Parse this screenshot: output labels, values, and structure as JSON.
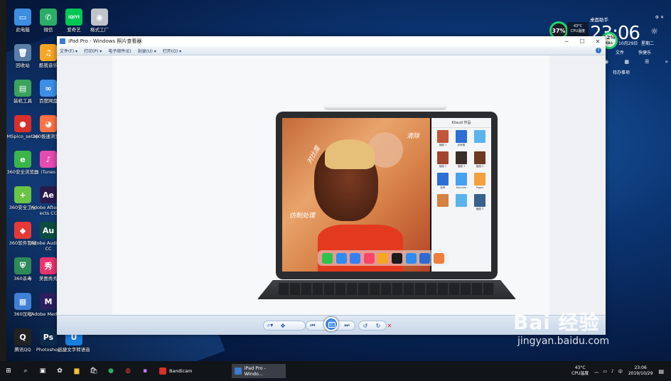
{
  "desktop": {
    "icons": [
      {
        "label": "此电脑",
        "glyph": "▭",
        "color": "#3c8ee0"
      },
      {
        "label": "微信",
        "glyph": "✆",
        "color": "#2aae67"
      },
      {
        "label": "爱奇艺",
        "glyph": "iQIYI",
        "color": "#00c853"
      },
      {
        "label": "格式工厂",
        "glyph": "◉",
        "color": "#c0c5cc"
      },
      {
        "label": "回收站",
        "glyph": "🗑",
        "color": "#5a7ea8"
      },
      {
        "label": "酷我音乐",
        "glyph": "♫",
        "color": "#f6a623"
      },
      {
        "label": "装机工具",
        "glyph": "▤",
        "color": "#3aa35c"
      },
      {
        "label": "百度网盘",
        "glyph": "∞",
        "color": "#3d8ee8"
      },
      {
        "label": "MSpico_setup",
        "glyph": "●",
        "color": "#d9302a"
      },
      {
        "label": "360极速浏览器",
        "glyph": "◕",
        "color": "#ff7043"
      },
      {
        "label": "360安全浏览器",
        "glyph": "e",
        "color": "#3ab54a"
      },
      {
        "label": "iTunes",
        "glyph": "♪",
        "color": "#e64bb0"
      },
      {
        "label": "360安全卫士",
        "glyph": "+",
        "color": "#6bc443"
      },
      {
        "label": "Adobe After Effects CC",
        "glyph": "Ae",
        "color": "#2a1b4d"
      },
      {
        "label": "360软件管家",
        "glyph": "◆",
        "color": "#e53935"
      },
      {
        "label": "Adobe Audition CC",
        "glyph": "Au",
        "color": "#0d4d40"
      },
      {
        "label": "360杀毒",
        "glyph": "⛨",
        "color": "#2e8b57"
      },
      {
        "label": "美图秀秀",
        "glyph": "秀",
        "color": "#e8336d"
      },
      {
        "label": "360压缩",
        "glyph": "▦",
        "color": "#3f7fd4"
      },
      {
        "label": "Adobe Media...",
        "glyph": "M",
        "color": "#2b1f5e"
      },
      {
        "label": "腾讯QQ",
        "glyph": "Q",
        "color": "#222222"
      },
      {
        "label": "Photoshop",
        "glyph": "Ps",
        "color": "#0b2a4a"
      },
      {
        "label": "迅捷文字转语音",
        "glyph": "U",
        "color": "#1a7fe0"
      }
    ]
  },
  "viewer": {
    "title": "iPad Pro - Windows 照片查看器",
    "menu": [
      "文件(F) ▾",
      "打印(P) ▾",
      "电子邮件(E)",
      "刻录(U) ▾",
      "打开(O) ▾"
    ],
    "help": "?"
  },
  "ipad": {
    "note1": "对比度",
    "note2": "仿制处理",
    "note3": "清除",
    "files_header": "Kilaud 作品",
    "files": [
      {
        "cap": "截图 1",
        "color": "#c2553a"
      },
      {
        "cap": "参考图",
        "color": "#2b6fd6"
      },
      {
        "cap": "",
        "color": "#5ab3ee"
      },
      {
        "cap": "截图 2",
        "color": "#a3452e"
      },
      {
        "cap": "截图 3",
        "color": "#3a2c28"
      },
      {
        "cap": "截图 4",
        "color": "#6d3a22"
      },
      {
        "cap": "参考",
        "color": "#2b6fd6"
      },
      {
        "cap": "Keynote",
        "color": "#47a0f0"
      },
      {
        "cap": "Pages",
        "color": "#f2a13b"
      },
      {
        "cap": "",
        "color": "#d7803f"
      },
      {
        "cap": "",
        "color": "#5ab3ee"
      },
      {
        "cap": "截图 5",
        "color": "#38618c"
      }
    ],
    "dock": [
      "#2ec34a",
      "#2e8cf0",
      "#3a7ef0",
      "#fb4469",
      "#f5a623",
      "#1b1b1b",
      "#2e8cf0",
      "#2f6ad1",
      "#ee7d3b"
    ]
  },
  "widget": {
    "title": "桌面助手",
    "time": "23:06",
    "date": "10月29日",
    "weekday": "星期二",
    "shortcut1": "文件",
    "shortcut2": "快捷乐",
    "todo": "待办事项",
    "gauge_left": "37%",
    "gauge_right": "12%",
    "cpu_temp": "43°C",
    "cpu_label": "CPU温度",
    "net": "KB/s"
  },
  "taskbar": {
    "apps": [
      {
        "label": "Bandicam",
        "color": "#d9302a"
      },
      {
        "label": "iPad Pro - Windo...",
        "color": "#3a7bd5"
      }
    ],
    "weather_temp": "43°C",
    "weather_label": "CPU温度",
    "clock_time": "23:06",
    "clock_date": "2019/10/29"
  },
  "watermark": {
    "brand": "Bai 经验",
    "url": "jingyan.baidu.com"
  }
}
